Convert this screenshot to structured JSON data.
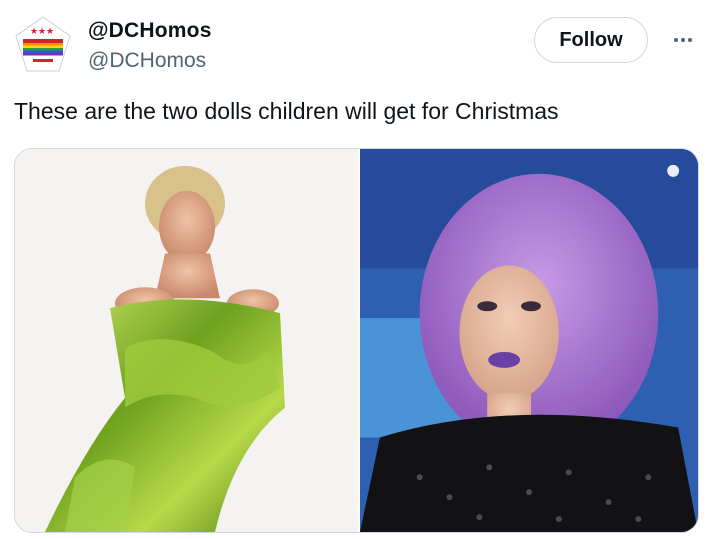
{
  "author": {
    "display_name": "@DCHomos",
    "handle": "@DCHomos",
    "avatar_icon": "dc-flag-pride-logo-icon"
  },
  "actions": {
    "follow_label": "Follow",
    "more_icon": "more-horizontal-icon"
  },
  "tweet": {
    "text": "These are the two dolls children will get for Christmas"
  },
  "media": {
    "count": 2,
    "photos": [
      {
        "name": "photo-green-metallic-outfit"
      },
      {
        "name": "photo-purple-wig-portrait"
      }
    ]
  },
  "colors": {
    "text_primary": "#0f1419",
    "text_secondary": "#536471",
    "border": "#cfd9de"
  }
}
